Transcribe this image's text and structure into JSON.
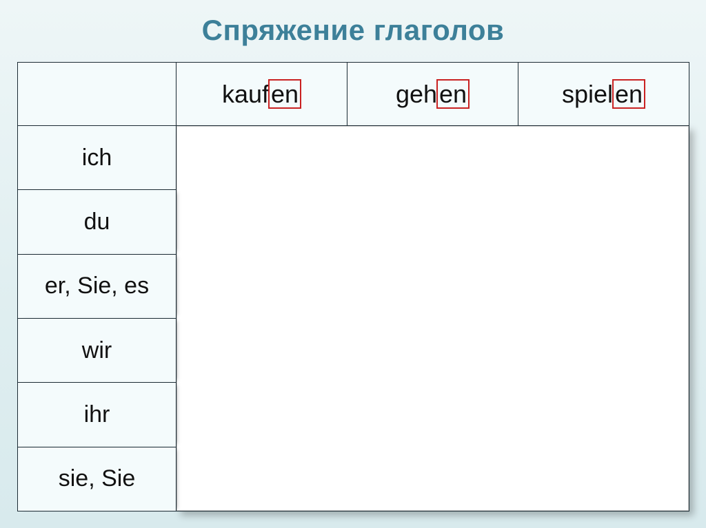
{
  "title": "Спряжение глаголов",
  "verbs": [
    {
      "stem": "kauf",
      "ending": "en"
    },
    {
      "stem": "geh",
      "ending": "en"
    },
    {
      "stem": "spiel",
      "ending": "en"
    }
  ],
  "pronouns": [
    "ich",
    "du",
    "er, Sie, es",
    "wir",
    "ihr",
    "sie, Sie"
  ]
}
